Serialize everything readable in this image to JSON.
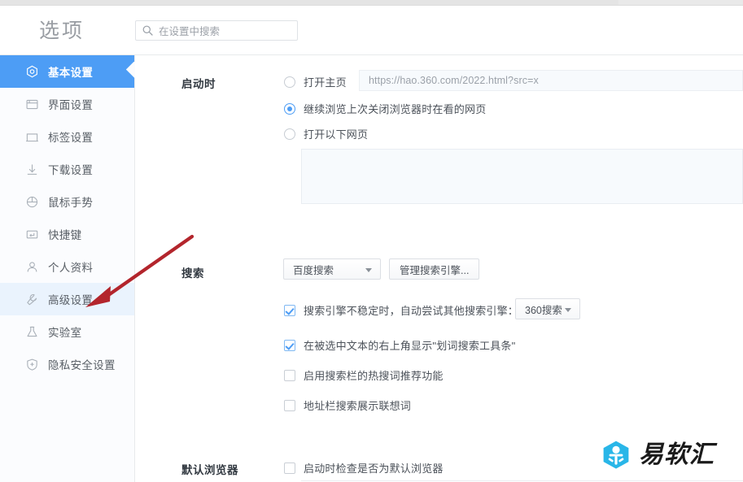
{
  "window": {
    "title": "选项"
  },
  "search": {
    "placeholder": "在设置中搜索",
    "value": "",
    "icon": "search-icon"
  },
  "sidebar": {
    "items": [
      {
        "label": "基本设置",
        "icon": "hexagon-target-icon",
        "state": "active"
      },
      {
        "label": "界面设置",
        "icon": "window-icon",
        "state": "normal"
      },
      {
        "label": "标签设置",
        "icon": "tab-icon",
        "state": "normal"
      },
      {
        "label": "下载设置",
        "icon": "download-arrow-icon",
        "state": "normal"
      },
      {
        "label": "鼠标手势",
        "icon": "mouse-icon",
        "state": "normal"
      },
      {
        "label": "快捷键",
        "icon": "keyboard-key-icon",
        "state": "normal"
      },
      {
        "label": "个人资料",
        "icon": "person-icon",
        "state": "normal"
      },
      {
        "label": "高级设置",
        "icon": "wrench-icon",
        "state": "highlight"
      },
      {
        "label": "实验室",
        "icon": "flask-icon",
        "state": "normal"
      },
      {
        "label": "隐私安全设置",
        "icon": "shield-plus-icon",
        "state": "normal"
      }
    ]
  },
  "startup": {
    "label": "启动时",
    "options": [
      {
        "text": "打开主页",
        "selected": false
      },
      {
        "text": "继续浏览上次关闭浏览器时在看的网页",
        "selected": true
      },
      {
        "text": "打开以下网页",
        "selected": false
      }
    ],
    "homepage_url": "https://hao.360.com/2022.html?src=x",
    "pages_textarea_value": ""
  },
  "search_section": {
    "label": "搜索",
    "engine_select": {
      "value": "百度搜索"
    },
    "manage_button": "管理搜索引擎...",
    "checkboxes": [
      {
        "text": "搜索引擎不稳定时，自动尝试其他搜索引擎：",
        "checked": true
      },
      {
        "text": "在被选中文本的右上角显示\"划词搜索工具条\"",
        "checked": true
      },
      {
        "text": "启用搜索栏的热搜词推荐功能",
        "checked": false
      },
      {
        "text": "地址栏搜索展示联想词",
        "checked": false
      }
    ],
    "fallback_engine_select": {
      "value": "360搜索"
    }
  },
  "default_browser": {
    "label": "默认浏览器",
    "checkbox": {
      "text": "启动时检查是否为默认浏览器",
      "checked": false
    }
  },
  "annotation": {
    "arrow_color": "#c1272d",
    "points_to": "高级设置"
  },
  "watermark": {
    "text": "易软汇",
    "logo_color": "#29b6e8"
  }
}
